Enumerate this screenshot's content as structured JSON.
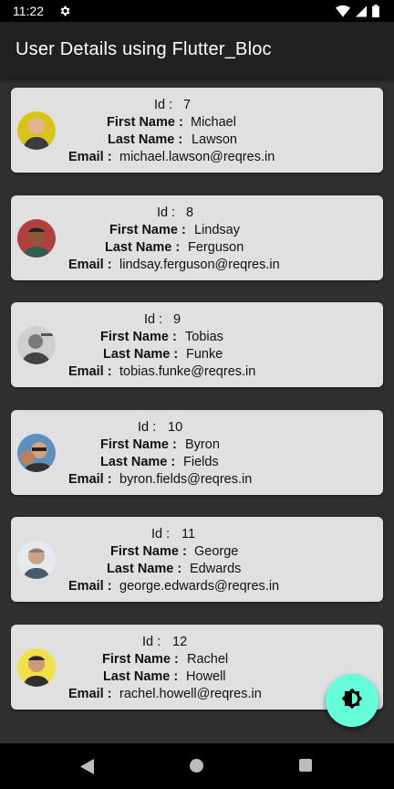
{
  "status": {
    "time": "11:22"
  },
  "app_bar": {
    "title": "User Details using Flutter_Bloc"
  },
  "labels": {
    "id": "Id :",
    "first_name": "First Name :",
    "last_name": "Last Name :",
    "email": "Email :"
  },
  "users": [
    {
      "id": "7",
      "first_name": "Michael",
      "last_name": "Lawson",
      "email": "michael.lawson@reqres.in"
    },
    {
      "id": "8",
      "first_name": "Lindsay",
      "last_name": "Ferguson",
      "email": "lindsay.ferguson@reqres.in"
    },
    {
      "id": "9",
      "first_name": "Tobias",
      "last_name": "Funke",
      "email": "tobias.funke@reqres.in"
    },
    {
      "id": "10",
      "first_name": "Byron",
      "last_name": "Fields",
      "email": "byron.fields@reqres.in"
    },
    {
      "id": "11",
      "first_name": "George",
      "last_name": "Edwards",
      "email": "george.edwards@reqres.in"
    },
    {
      "id": "12",
      "first_name": "Rachel",
      "last_name": "Howell",
      "email": "rachel.howell@reqres.in"
    }
  ],
  "fab": {
    "icon": "brightness-icon"
  },
  "colors": {
    "fab": "#64ffda",
    "card": "#e0e0e0",
    "background": "#303030",
    "app_bar": "#212121"
  }
}
